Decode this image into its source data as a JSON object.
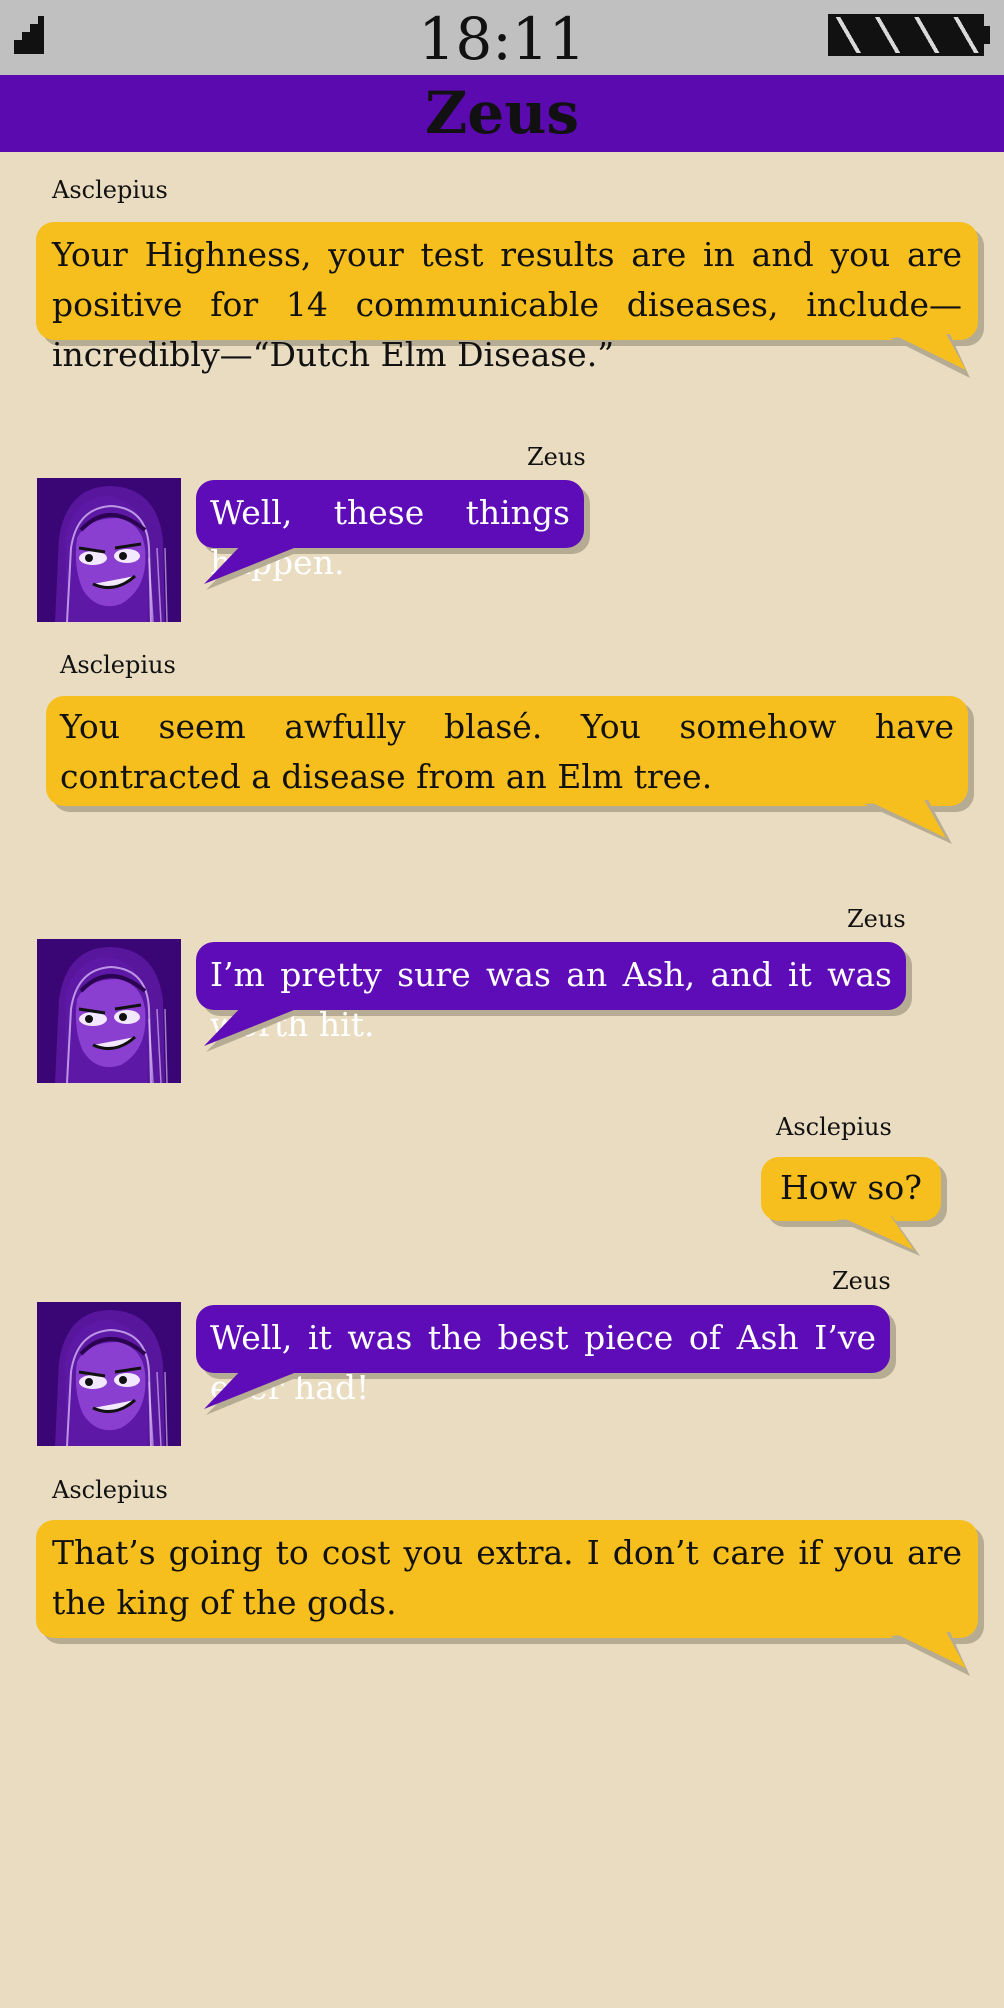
{
  "status_bar": {
    "time": "18:11"
  },
  "header": {
    "title": "Zeus"
  },
  "colors": {
    "asclepius_bubble": "#f6bf1e",
    "zeus_bubble": "#5e0cb7",
    "header_bar": "#5b0aaf",
    "background": "#e9dcc0",
    "status_bar": "#c0c0c0"
  },
  "messages": [
    {
      "sender": "Asclepius",
      "text": "Your Highness, your test results are in and you are positive for 14 communicable diseases, include—incredibly—“Dutch Elm Disease.”"
    },
    {
      "sender": "Zeus",
      "text": "Well, these things happen."
    },
    {
      "sender": "Asclepius",
      "text": "You seem awfully blasé. You somehow have contracted a disease from an Elm tree."
    },
    {
      "sender": "Zeus",
      "text": "I’m pretty sure was an Ash, and it was worth hit."
    },
    {
      "sender": "Asclepius",
      "text": "How so?"
    },
    {
      "sender": "Zeus",
      "text": "Well, it was the best piece of Ash I’ve ever had!"
    },
    {
      "sender": "Asclepius",
      "text": "That’s going to cost you extra. I don’t care if you are the king of the gods."
    }
  ]
}
